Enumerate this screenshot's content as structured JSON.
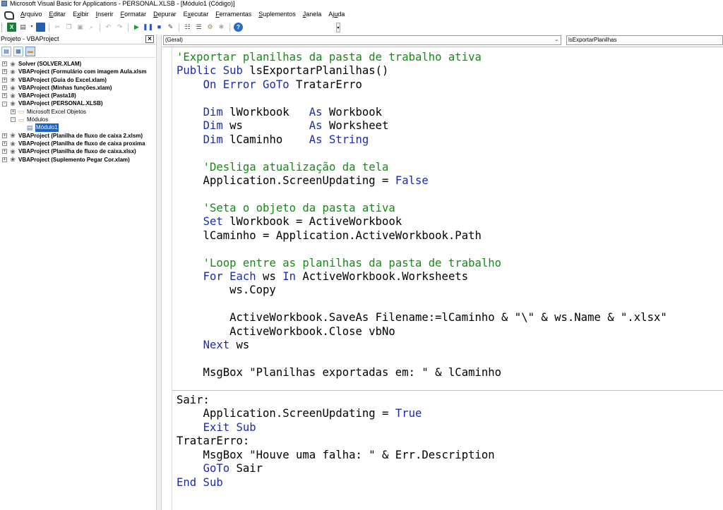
{
  "window": {
    "title": "Microsoft Visual Basic for Applications - PERSONAL.XLSB - [Módulo1 (Código)]"
  },
  "menu": [
    {
      "pre": "",
      "u": "A",
      "post": "rquivo"
    },
    {
      "pre": "",
      "u": "E",
      "post": "ditar"
    },
    {
      "pre": "E",
      "u": "x",
      "post": "ibir"
    },
    {
      "pre": "",
      "u": "I",
      "post": "nserir"
    },
    {
      "pre": "",
      "u": "F",
      "post": "ormatar"
    },
    {
      "pre": "",
      "u": "D",
      "post": "epurar"
    },
    {
      "pre": "E",
      "u": "x",
      "post": "ecutar"
    },
    {
      "pre": "",
      "u": "F",
      "post": "erramentas"
    },
    {
      "pre": "",
      "u": "S",
      "post": "uplementos"
    },
    {
      "pre": "",
      "u": "J",
      "post": "anela"
    },
    {
      "pre": "Aj",
      "u": "u",
      "post": "da"
    }
  ],
  "project": {
    "title": "Projeto - VBAProject",
    "close_glyph": "×",
    "tree": [
      {
        "level": 0,
        "toggle": "+",
        "icon": "vbaproject",
        "label": "Solver (SOLVER.XLAM)",
        "style": "bold"
      },
      {
        "level": 0,
        "toggle": "+",
        "icon": "vbaproject",
        "label": "VBAProject (Formulário com imagem Aula.xlsm",
        "style": "bold"
      },
      {
        "level": 0,
        "toggle": "+",
        "icon": "vbaproject",
        "label": "VBAProject (Guia do Excel.xlam)",
        "style": "bold"
      },
      {
        "level": 0,
        "toggle": "+",
        "icon": "vbaproject",
        "label": "VBAProject (Minhas funções.xlam)",
        "style": "bold"
      },
      {
        "level": 0,
        "toggle": "+",
        "icon": "vbaproject",
        "label": "VBAProject (Pasta18)",
        "style": "bold"
      },
      {
        "level": 0,
        "toggle": "−",
        "icon": "vbaproject",
        "label": "VBAProject (PERSONAL.XLSB)",
        "style": "bold"
      },
      {
        "level": 1,
        "toggle": "+",
        "icon": "folder",
        "label": "Microsoft Excel Objetos",
        "style": "normal"
      },
      {
        "level": 1,
        "toggle": "−",
        "icon": "folder",
        "label": "Módulos",
        "style": "normal"
      },
      {
        "level": 2,
        "toggle": "",
        "icon": "module",
        "label": "Módulo1",
        "style": "selected"
      },
      {
        "level": 0,
        "toggle": "+",
        "icon": "vbaproject",
        "label": "VBAProject (Planilha de fluxo de caixa 2.xlsm)",
        "style": "bold"
      },
      {
        "level": 0,
        "toggle": "+",
        "icon": "vbaproject",
        "label": "VBAProject (Planilha de fluxo de caixa proxima",
        "style": "bold"
      },
      {
        "level": 0,
        "toggle": "+",
        "icon": "vbaproject",
        "label": "VBAProject (Planilha de fluxo de caixa.xlsx)",
        "style": "bold"
      },
      {
        "level": 0,
        "toggle": "+",
        "icon": "vbaproject",
        "label": "VBAProject (Suplemento Pegar Cor.xlam)",
        "style": "bold"
      }
    ]
  },
  "code": {
    "object_combo": "(Geral)",
    "procedure_combo": "lsExportarPlanilhas",
    "lines": [
      [
        {
          "t": "cm",
          "s": "'Exportar planilhas da pasta de trabalho ativa"
        }
      ],
      [
        {
          "t": "kw",
          "s": "Public Sub"
        },
        {
          "t": "",
          "s": " lsExportarPlanilhas()"
        }
      ],
      [
        {
          "t": "",
          "s": "    "
        },
        {
          "t": "kw",
          "s": "On Error GoTo"
        },
        {
          "t": "",
          "s": " TratarErro"
        }
      ],
      [],
      [
        {
          "t": "",
          "s": "    "
        },
        {
          "t": "kw",
          "s": "Dim"
        },
        {
          "t": "",
          "s": " lWorkbook   "
        },
        {
          "t": "kw",
          "s": "As"
        },
        {
          "t": "",
          "s": " Workbook"
        }
      ],
      [
        {
          "t": "",
          "s": "    "
        },
        {
          "t": "kw",
          "s": "Dim"
        },
        {
          "t": "",
          "s": " ws          "
        },
        {
          "t": "kw",
          "s": "As"
        },
        {
          "t": "",
          "s": " Worksheet"
        }
      ],
      [
        {
          "t": "",
          "s": "    "
        },
        {
          "t": "kw",
          "s": "Dim"
        },
        {
          "t": "",
          "s": " lCaminho    "
        },
        {
          "t": "kw",
          "s": "As String"
        }
      ],
      [],
      [
        {
          "t": "",
          "s": "    "
        },
        {
          "t": "cm",
          "s": "'Desliga atualização da tela"
        }
      ],
      [
        {
          "t": "",
          "s": "    Application.ScreenUpdating = "
        },
        {
          "t": "kw",
          "s": "False"
        }
      ],
      [],
      [
        {
          "t": "",
          "s": "    "
        },
        {
          "t": "cm",
          "s": "'Seta o objeto da pasta ativa"
        }
      ],
      [
        {
          "t": "",
          "s": "    "
        },
        {
          "t": "kw",
          "s": "Set"
        },
        {
          "t": "",
          "s": " lWorkbook = ActiveWorkbook"
        }
      ],
      [
        {
          "t": "",
          "s": "    lCaminho = Application.ActiveWorkbook.Path"
        }
      ],
      [],
      [
        {
          "t": "",
          "s": "    "
        },
        {
          "t": "cm",
          "s": "'Loop entre as planilhas da pasta de trabalho"
        }
      ],
      [
        {
          "t": "",
          "s": "    "
        },
        {
          "t": "kw",
          "s": "For Each"
        },
        {
          "t": "",
          "s": " ws "
        },
        {
          "t": "kw",
          "s": "In"
        },
        {
          "t": "",
          "s": " ActiveWorkbook.Worksheets"
        }
      ],
      [
        {
          "t": "",
          "s": "        ws.Copy"
        }
      ],
      [],
      [
        {
          "t": "",
          "s": "        ActiveWorkbook.SaveAs Filename:=lCaminho & \"\\\" & ws.Name & \".xlsx\""
        }
      ],
      [
        {
          "t": "",
          "s": "        ActiveWorkbook.Close vbNo"
        }
      ],
      [
        {
          "t": "",
          "s": "    "
        },
        {
          "t": "kw",
          "s": "Next"
        },
        {
          "t": "",
          "s": " ws"
        }
      ],
      [],
      [
        {
          "t": "",
          "s": "    MsgBox \"Planilhas exportadas em: \" & lCaminho"
        }
      ],
      [],
      [
        {
          "t": "",
          "s": "Sair:"
        }
      ],
      [
        {
          "t": "",
          "s": "    Application.ScreenUpdating = "
        },
        {
          "t": "kw",
          "s": "True"
        }
      ],
      [
        {
          "t": "",
          "s": "    "
        },
        {
          "t": "kw",
          "s": "Exit Sub"
        }
      ],
      [
        {
          "t": "",
          "s": "TratarErro:"
        }
      ],
      [
        {
          "t": "",
          "s": "    MsgBox \"Houve uma falha: \" & Err.Description"
        }
      ],
      [
        {
          "t": "",
          "s": "    "
        },
        {
          "t": "kw",
          "s": "GoTo"
        },
        {
          "t": "",
          "s": " Sair"
        }
      ],
      [
        {
          "t": "kw",
          "s": "End Sub"
        }
      ]
    ]
  },
  "colors": {
    "keyword": "#1a2cae",
    "comment": "#138a13",
    "selection": "#1a64c8"
  }
}
